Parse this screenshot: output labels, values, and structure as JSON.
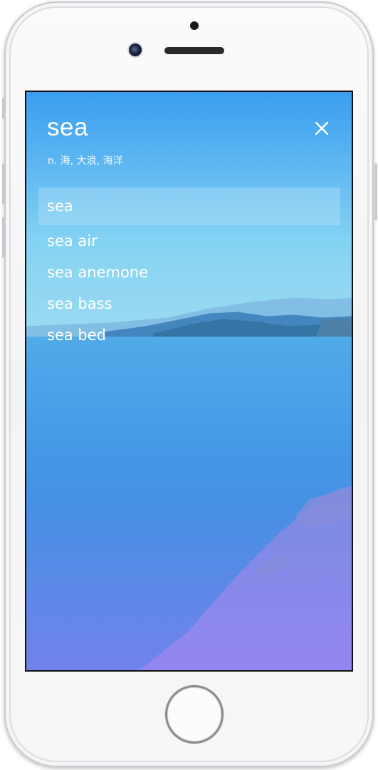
{
  "header": {
    "word": "sea",
    "definition": "n. 海, 大浪, 海洋"
  },
  "suggestions": [
    {
      "label": "sea",
      "selected": true
    },
    {
      "label": "sea air",
      "selected": false
    },
    {
      "label": "sea anemone",
      "selected": false
    },
    {
      "label": "sea bass",
      "selected": false
    },
    {
      "label": "sea bed",
      "selected": false
    }
  ],
  "icons": {
    "close": "close-icon"
  },
  "colors": {
    "text": "#ffffff",
    "sky_top": "#3fa3ee",
    "sea": "#3f95e6",
    "bottom_tint": "#8a7ff2"
  }
}
